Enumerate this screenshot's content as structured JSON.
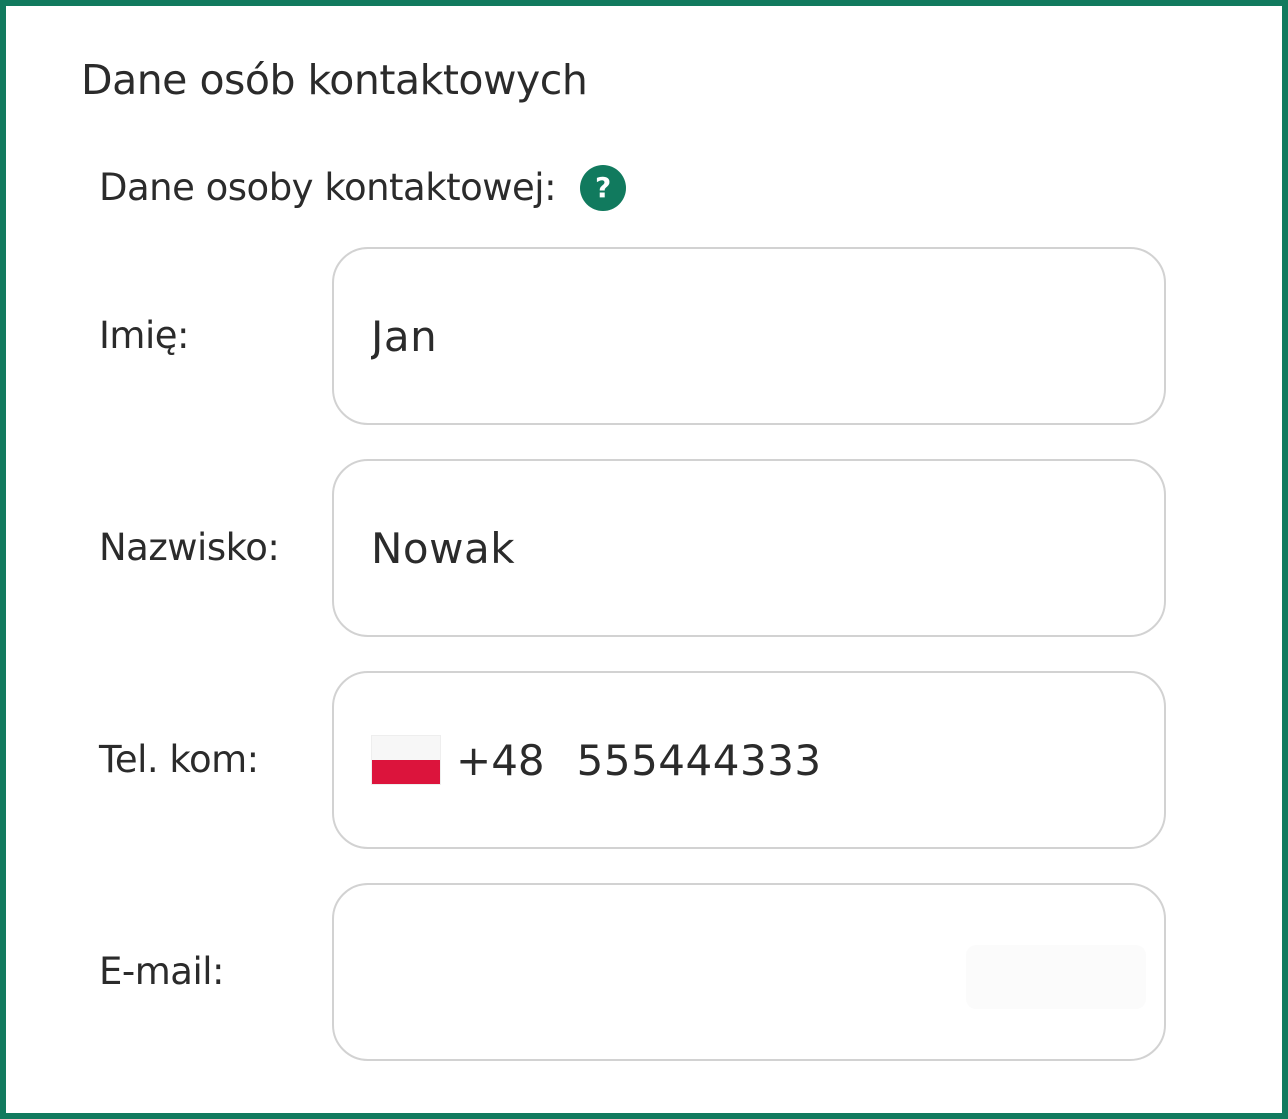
{
  "section": {
    "title": "Dane osób kontaktowych"
  },
  "subsection": {
    "label": "Dane osoby kontaktowej:",
    "help_icon": "question-circle-icon",
    "help_glyph": "?"
  },
  "fields": {
    "first_name": {
      "label": "Imię:",
      "value": "Jan"
    },
    "last_name": {
      "label": "Nazwisko:",
      "value": "Nowak"
    },
    "mobile_phone": {
      "label": "Tel. kom:",
      "country_flag_icon": "poland-flag-icon",
      "dial_code": "+48",
      "value": "555444333"
    },
    "email": {
      "label": "E-mail:",
      "value": ""
    }
  },
  "colors": {
    "accent": "#117a5e",
    "field_border": "#d2d2d2",
    "text": "#2b2b2b",
    "flag_white": "#f7f7f7",
    "flag_red": "#dc143c"
  }
}
